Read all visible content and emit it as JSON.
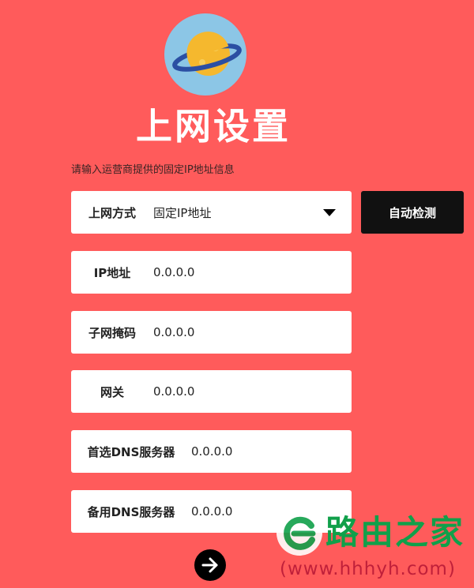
{
  "page": {
    "title": "上网设置",
    "hint": "请输入运营商提供的固定IP地址信息"
  },
  "form": {
    "connection_type": {
      "label": "上网方式",
      "value": "固定IP地址"
    },
    "ip_address": {
      "label": "IP地址",
      "value": "0.0.0.0"
    },
    "subnet_mask": {
      "label": "子网掩码",
      "value": "0.0.0.0"
    },
    "gateway": {
      "label": "网关",
      "value": "0.0.0.0"
    },
    "primary_dns": {
      "label": "首选DNS服务器",
      "value": "0.0.0.0"
    },
    "secondary_dns": {
      "label": "备用DNS服务器",
      "value": "0.0.0.0"
    }
  },
  "buttons": {
    "auto_detect": "自动检测",
    "next_icon": "arrow-right-icon"
  },
  "logo": {
    "icon": "planet-icon"
  },
  "watermark": {
    "name": "路由之家",
    "url": "(www.hhhyh.com)",
    "icon": "leaf-e-icon"
  },
  "colors": {
    "background": "#ff5b5b",
    "card": "#ffffff",
    "button": "#111111",
    "logo_bg": "#8cc6e6",
    "planet": "#f5b82e",
    "ring": "#2b4fa3",
    "watermark_green": "#10a04a",
    "watermark_red": "#c0203a"
  }
}
